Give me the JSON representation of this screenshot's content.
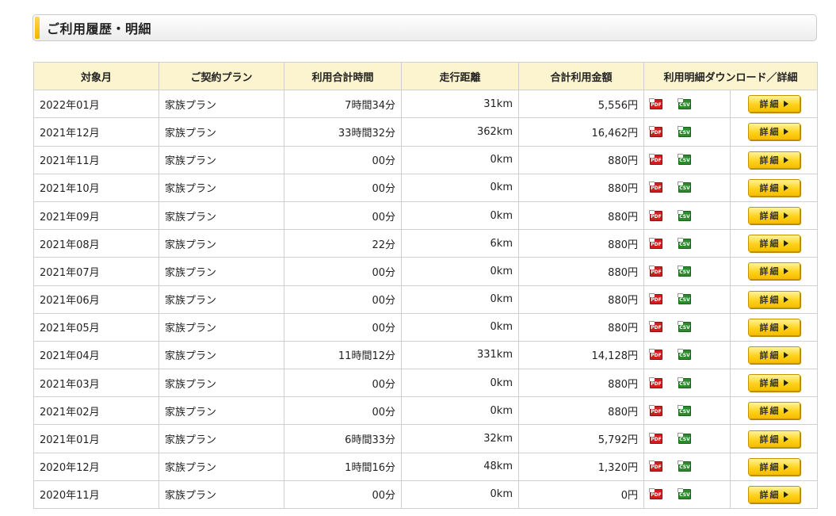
{
  "section": {
    "title": "ご利用履歴・明細"
  },
  "table": {
    "headers": [
      "対象月",
      "ご契約プラン",
      "利用合計時間",
      "走行距離",
      "合計利用金額",
      "利用明細ダウンロード／詳細"
    ],
    "icons": {
      "pdf": "PDF",
      "csv": "CSV"
    },
    "detail_label": "詳細",
    "rows": [
      [
        "2022年01月",
        "家族プラン",
        "7時間34分",
        "31km",
        "5,556円"
      ],
      [
        "2021年12月",
        "家族プラン",
        "33時間32分",
        "362km",
        "16,462円"
      ],
      [
        "2021年11月",
        "家族プラン",
        "00分",
        "0km",
        "880円"
      ],
      [
        "2021年10月",
        "家族プラン",
        "00分",
        "0km",
        "880円"
      ],
      [
        "2021年09月",
        "家族プラン",
        "00分",
        "0km",
        "880円"
      ],
      [
        "2021年08月",
        "家族プラン",
        "22分",
        "6km",
        "880円"
      ],
      [
        "2021年07月",
        "家族プラン",
        "00分",
        "0km",
        "880円"
      ],
      [
        "2021年06月",
        "家族プラン",
        "00分",
        "0km",
        "880円"
      ],
      [
        "2021年05月",
        "家族プラン",
        "00分",
        "0km",
        "880円"
      ],
      [
        "2021年04月",
        "家族プラン",
        "11時間12分",
        "331km",
        "14,128円"
      ],
      [
        "2021年03月",
        "家族プラン",
        "00分",
        "0km",
        "880円"
      ],
      [
        "2021年02月",
        "家族プラン",
        "00分",
        "0km",
        "880円"
      ],
      [
        "2021年01月",
        "家族プラン",
        "6時間33分",
        "32km",
        "5,792円"
      ],
      [
        "2020年12月",
        "家族プラン",
        "1時間16分",
        "48km",
        "1,320円"
      ],
      [
        "2020年11月",
        "家族プラン",
        "00分",
        "0km",
        "0円"
      ]
    ]
  }
}
